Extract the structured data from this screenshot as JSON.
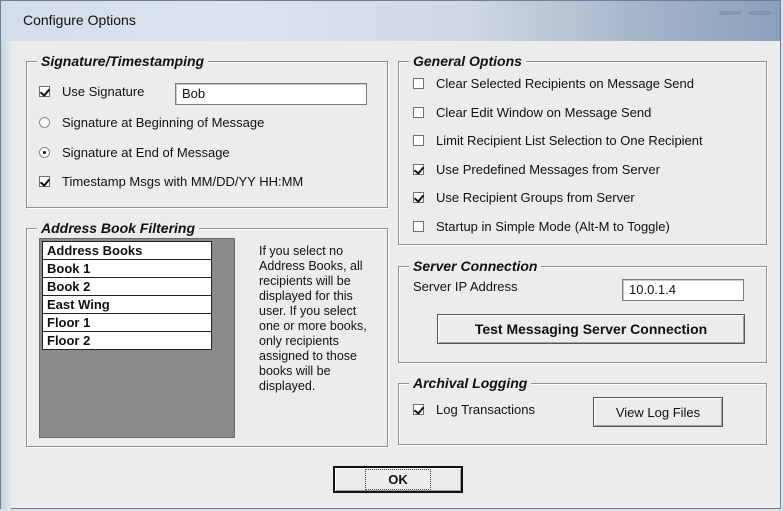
{
  "window": {
    "title": "Configure Options"
  },
  "signature": {
    "legend": "Signature/Timestamping",
    "use_signature_label": "Use Signature",
    "use_signature_checked": true,
    "signature_value": "Bob",
    "sig_begin_label": "Signature at Beginning of Message",
    "sig_end_label": "Signature at End of Message",
    "selected_position": "end",
    "timestamp_label": "Timestamp Msgs with MM/DD/YY HH:MM",
    "timestamp_checked": true
  },
  "address_book": {
    "legend": "Address Book Filtering",
    "header": "Address Books",
    "books": [
      "Book 1",
      "Book 2",
      "East Wing",
      "Floor 1",
      "Floor 2"
    ],
    "note": "If you select no Address Books, all recipients will be displayed for this user.  If you select one or more books, only recipients assigned to those books will be displayed."
  },
  "general": {
    "legend": "General Options",
    "options": [
      {
        "label": "Clear Selected Recipients on Message Send",
        "checked": false
      },
      {
        "label": "Clear Edit Window on Message Send",
        "checked": false
      },
      {
        "label": "Limit Recipient List Selection to One Recipient",
        "checked": false
      },
      {
        "label": "Use Predefined Messages from Server",
        "checked": true
      },
      {
        "label": "Use Recipient Groups from Server",
        "checked": true
      },
      {
        "label": "Startup in Simple Mode (Alt-M to Toggle)",
        "checked": false
      }
    ]
  },
  "server": {
    "legend": "Server Connection",
    "ip_label": "Server IP Address",
    "ip_value": "10.0.1.4",
    "test_button": "Test Messaging Server Connection"
  },
  "archival": {
    "legend": "Archival Logging",
    "log_label": "Log Transactions",
    "log_checked": true,
    "view_button": "View Log Files"
  },
  "ok_button": "OK"
}
